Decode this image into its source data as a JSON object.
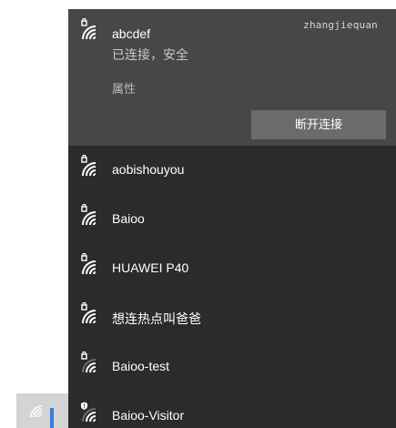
{
  "watermark": "zhangjiequan",
  "connected_network": {
    "ssid": "abcdef",
    "status": "已连接，安全",
    "properties_link": "属性",
    "disconnect_button": "断开连接",
    "icon": "wifi-secured-icon"
  },
  "networks": [
    {
      "ssid": "aobishouyou",
      "icon": "wifi-secured-icon"
    },
    {
      "ssid": "Baioo",
      "icon": "wifi-secured-icon"
    },
    {
      "ssid": "HUAWEI P40",
      "icon": "wifi-secured-icon"
    },
    {
      "ssid": "想连热点叫爸爸",
      "icon": "wifi-secured-icon"
    },
    {
      "ssid": "Baioo-test",
      "icon": "wifi-secured-weak-icon"
    },
    {
      "ssid": "Baioo-Visitor",
      "icon": "wifi-shield-icon"
    }
  ],
  "taskbar": {
    "icon": "wifi-icon"
  },
  "colors": {
    "flyout_bg": "#2b2b2b",
    "connected_bg": "#474747",
    "button_bg": "#6b6b6b",
    "accent": "#3a7bd5"
  }
}
